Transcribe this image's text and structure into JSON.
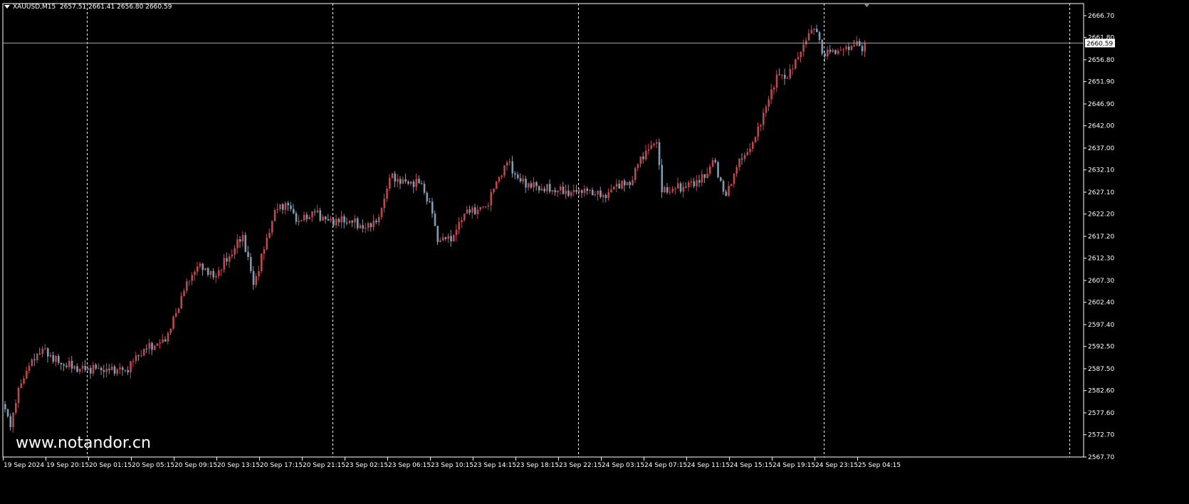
{
  "header": {
    "symbol": "XAUUSD,M15",
    "open": "2657.51",
    "high": "2661.41",
    "low": "2656.80",
    "close": "2660.59"
  },
  "watermark": "www.notandor.cn",
  "colors": {
    "background": "#000000",
    "up": "#c0484c",
    "down": "#7f9db2",
    "grid": "#ffffff",
    "axis_text": "#ffffff",
    "price_line": "#a0a0a0"
  },
  "chart_data": {
    "type": "candlestick",
    "title": "XAUUSD,M15",
    "ylim": [
      2567.7,
      2666.7
    ],
    "current_price": 2660.59,
    "current_price_label": "2660.59",
    "y_ticks": [
      "2666.70",
      "2661.80",
      "2656.80",
      "2651.90",
      "2646.90",
      "2642.00",
      "2637.00",
      "2632.10",
      "2627.10",
      "2622.20",
      "2617.20",
      "2612.30",
      "2607.30",
      "2602.40",
      "2597.40",
      "2592.50",
      "2587.50",
      "2582.60",
      "2577.60",
      "2572.70",
      "2567.70"
    ],
    "x_ticks": [
      "19 Sep 2024",
      "19 Sep 20:15",
      "20 Sep 01:15",
      "20 Sep 05:15",
      "20 Sep 09:15",
      "20 Sep 13:15",
      "20 Sep 17:15",
      "20 Sep 21:15",
      "23 Sep 02:15",
      "23 Sep 06:15",
      "23 Sep 10:15",
      "23 Sep 14:15",
      "23 Sep 18:15",
      "23 Sep 22:15",
      "24 Sep 03:15",
      "24 Sep 07:15",
      "24 Sep 11:15",
      "24 Sep 15:15",
      "24 Sep 19:15",
      "24 Sep 23:15",
      "25 Sep 04:15"
    ],
    "bars_per_x_tick": 16,
    "day_separators_at_bar": [
      31,
      123,
      215,
      307,
      399
    ],
    "close_path_bar_price": [
      [
        0,
        2578.4
      ],
      [
        2,
        2574.4
      ],
      [
        5,
        2583.2
      ],
      [
        10,
        2589.6
      ],
      [
        14,
        2592.0
      ],
      [
        20,
        2588.8
      ],
      [
        28,
        2587.5
      ],
      [
        38,
        2587.5
      ],
      [
        45,
        2587.2
      ],
      [
        52,
        2592.0
      ],
      [
        60,
        2593.6
      ],
      [
        64,
        2600.0
      ],
      [
        68,
        2607.1
      ],
      [
        73,
        2611.1
      ],
      [
        78,
        2608.0
      ],
      [
        84,
        2612.7
      ],
      [
        89,
        2617.5
      ],
      [
        93,
        2606.3
      ],
      [
        97,
        2614.3
      ],
      [
        101,
        2623.1
      ],
      [
        105,
        2624.7
      ],
      [
        110,
        2620.7
      ],
      [
        116,
        2622.6
      ],
      [
        121,
        2620.7
      ],
      [
        129,
        2620.7
      ],
      [
        135,
        2619.1
      ],
      [
        140,
        2621.5
      ],
      [
        144,
        2630.3
      ],
      [
        150,
        2629.5
      ],
      [
        156,
        2629.0
      ],
      [
        160,
        2622.3
      ],
      [
        162,
        2615.9
      ],
      [
        168,
        2617.5
      ],
      [
        172,
        2622.3
      ],
      [
        180,
        2623.9
      ],
      [
        184,
        2629.5
      ],
      [
        188,
        2633.8
      ],
      [
        193,
        2629.5
      ],
      [
        201,
        2627.9
      ],
      [
        212,
        2627.1
      ],
      [
        217,
        2627.9
      ],
      [
        225,
        2625.8
      ],
      [
        229,
        2629.0
      ],
      [
        234,
        2628.7
      ],
      [
        238,
        2635.1
      ],
      [
        244,
        2638.3
      ],
      [
        246,
        2627.1
      ],
      [
        250,
        2627.9
      ],
      [
        254,
        2628.3
      ],
      [
        262,
        2630.3
      ],
      [
        265,
        2634.3
      ],
      [
        270,
        2626.3
      ],
      [
        274,
        2632.7
      ],
      [
        280,
        2638.3
      ],
      [
        285,
        2646.3
      ],
      [
        289,
        2653.5
      ],
      [
        293,
        2652.7
      ],
      [
        297,
        2657.4
      ],
      [
        302,
        2663.5
      ],
      [
        304,
        2663.0
      ],
      [
        306,
        2658.2
      ],
      [
        310,
        2659.0
      ],
      [
        316,
        2659.0
      ],
      [
        319,
        2661.0
      ],
      [
        321,
        2658.7
      ],
      [
        322,
        2660.59
      ]
    ]
  }
}
